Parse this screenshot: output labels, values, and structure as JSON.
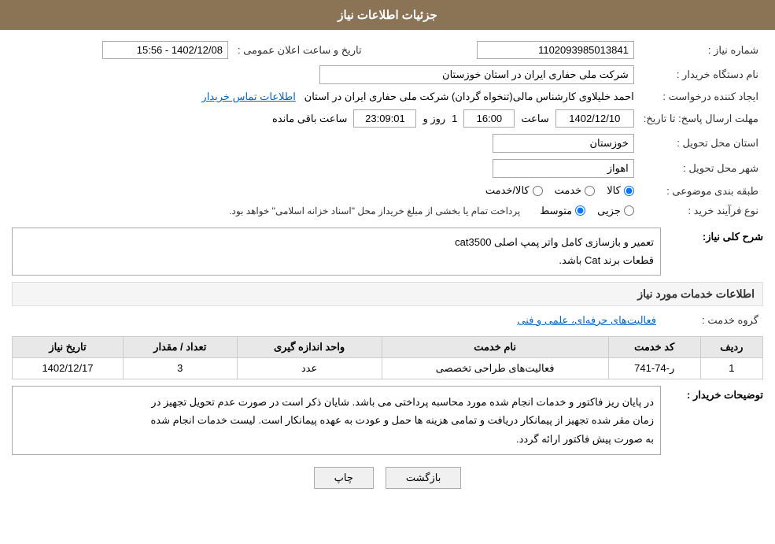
{
  "header": {
    "title": "جزئیات اطلاعات نیاز"
  },
  "fields": {
    "need_number_label": "شماره نیاز :",
    "need_number_value": "1102093985013841",
    "buyer_org_label": "نام دستگاه خریدار :",
    "buyer_org_value": "شرکت ملی حفاری ایران در استان خوزستان",
    "creator_label": "ایجاد کننده درخواست :",
    "creator_value": "احمد خلیلاوی کارشناس مالی(تنخواه گردان) شرکت ملی حفاری ایران در استان",
    "creator_link": "اطلاعات تماس خریدار",
    "announce_datetime_label": "تاریخ و ساعت اعلان عمومی :",
    "announce_datetime_value": "1402/12/08 - 15:56",
    "deadline_label": "مهلت ارسال پاسخ: تا تاریخ:",
    "deadline_date": "1402/12/10",
    "deadline_time_label": "ساعت",
    "deadline_time": "16:00",
    "deadline_day_label": "روز و",
    "deadline_days": "1",
    "deadline_countdown_label": "ساعت باقی مانده",
    "deadline_countdown": "23:09:01",
    "province_label": "استان محل تحویل :",
    "province_value": "خوزستان",
    "city_label": "شهر محل تحویل :",
    "city_value": "اهواز",
    "category_label": "طبقه بندی موضوعی :",
    "category_options": [
      "کالا",
      "خدمت",
      "کالا/خدمت"
    ],
    "category_selected": "کالا",
    "purchase_type_label": "نوع فرآیند خرید :",
    "purchase_type_options": [
      "جزیی",
      "متوسط"
    ],
    "purchase_type_selected": "متوسط",
    "purchase_type_note": "پرداخت تمام یا بخشی از مبلغ خریداز محل \"اسناد خزانه اسلامی\" خواهد بود.",
    "description_section_title": "شرح کلی نیاز:",
    "description_line1": "تعمیر و بازسازی کامل واتر پمپ اصلی cat3500",
    "description_line2": "قطعات برند Cat باشد.",
    "services_section_title": "اطلاعات خدمات مورد نیاز",
    "service_group_label": "گروه خدمت :",
    "service_group_value": "فعالیت‌های حرفه‌ای، علمی و فنی",
    "table": {
      "headers": [
        "ردیف",
        "کد خدمت",
        "نام خدمت",
        "واحد اندازه گیری",
        "تعداد / مقدار",
        "تاریخ نیاز"
      ],
      "rows": [
        {
          "row_num": "1",
          "service_code": "ر-74-741",
          "service_name": "فعالیت‌های طراحی تخصصی",
          "unit": "عدد",
          "quantity": "3",
          "date": "1402/12/17"
        }
      ]
    },
    "buyer_notes_label": "توضیحات خریدار :",
    "buyer_notes_line1": "در پایان ریز فاکتور و خدمات انجام شده مورد محاسبه پرداختی می باشد. شایان ذکر است در صورت عدم تحویل تجهیز در",
    "buyer_notes_line2": "زمان مقر شده تجهیز از پیمانکار دریافت و تمامی هزینه ها حمل و عودت به عهده پیمانکار است.  لیست خدمات انجام شده",
    "buyer_notes_line3": "به صورت پیش فاکتور ارائه گردد."
  },
  "buttons": {
    "back_label": "بازگشت",
    "print_label": "چاپ"
  }
}
